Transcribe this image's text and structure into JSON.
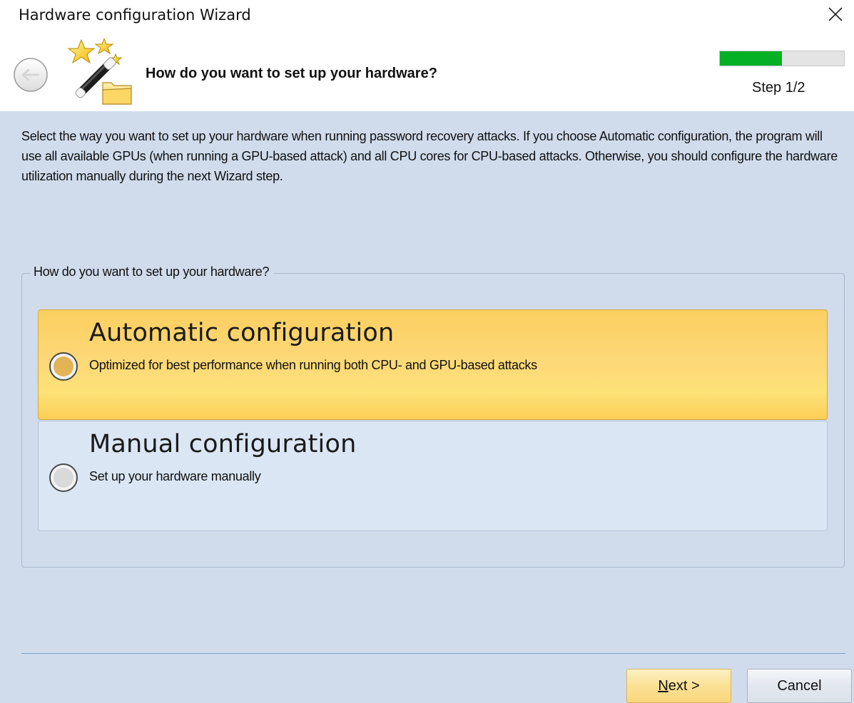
{
  "window": {
    "title": "Hardware configuration Wizard"
  },
  "header": {
    "title": "How do you want to set up your hardware?",
    "step_label": "Step 1/2",
    "progress_fraction": 0.5
  },
  "main": {
    "description": "Select the way you want to set up your hardware when running password recovery attacks. If you choose Automatic configuration, the program will use all available GPUs (when running a GPU-based attack) and all CPU cores for CPU-based attacks. Otherwise, you should configure the hardware utilization manually during the next Wizard step.",
    "group_label": "How do you want to set up your hardware?",
    "options": [
      {
        "title": "Automatic configuration",
        "subtitle": "Optimized for best performance when running both CPU- and GPU-based attacks",
        "selected": true
      },
      {
        "title": "Manual configuration",
        "subtitle": "Set up your hardware manually",
        "selected": false
      }
    ]
  },
  "footer": {
    "next_label_underlined": "N",
    "next_label_rest": "ext >",
    "cancel_label": "Cancel"
  },
  "colors": {
    "progress_fill": "#06b025",
    "content_background": "#d0dcec",
    "selected_option": "#fdd877"
  },
  "icons": [
    "close-icon",
    "back-arrow-icon",
    "magic-wand-icon",
    "folder-icon",
    "radio-icon"
  ]
}
